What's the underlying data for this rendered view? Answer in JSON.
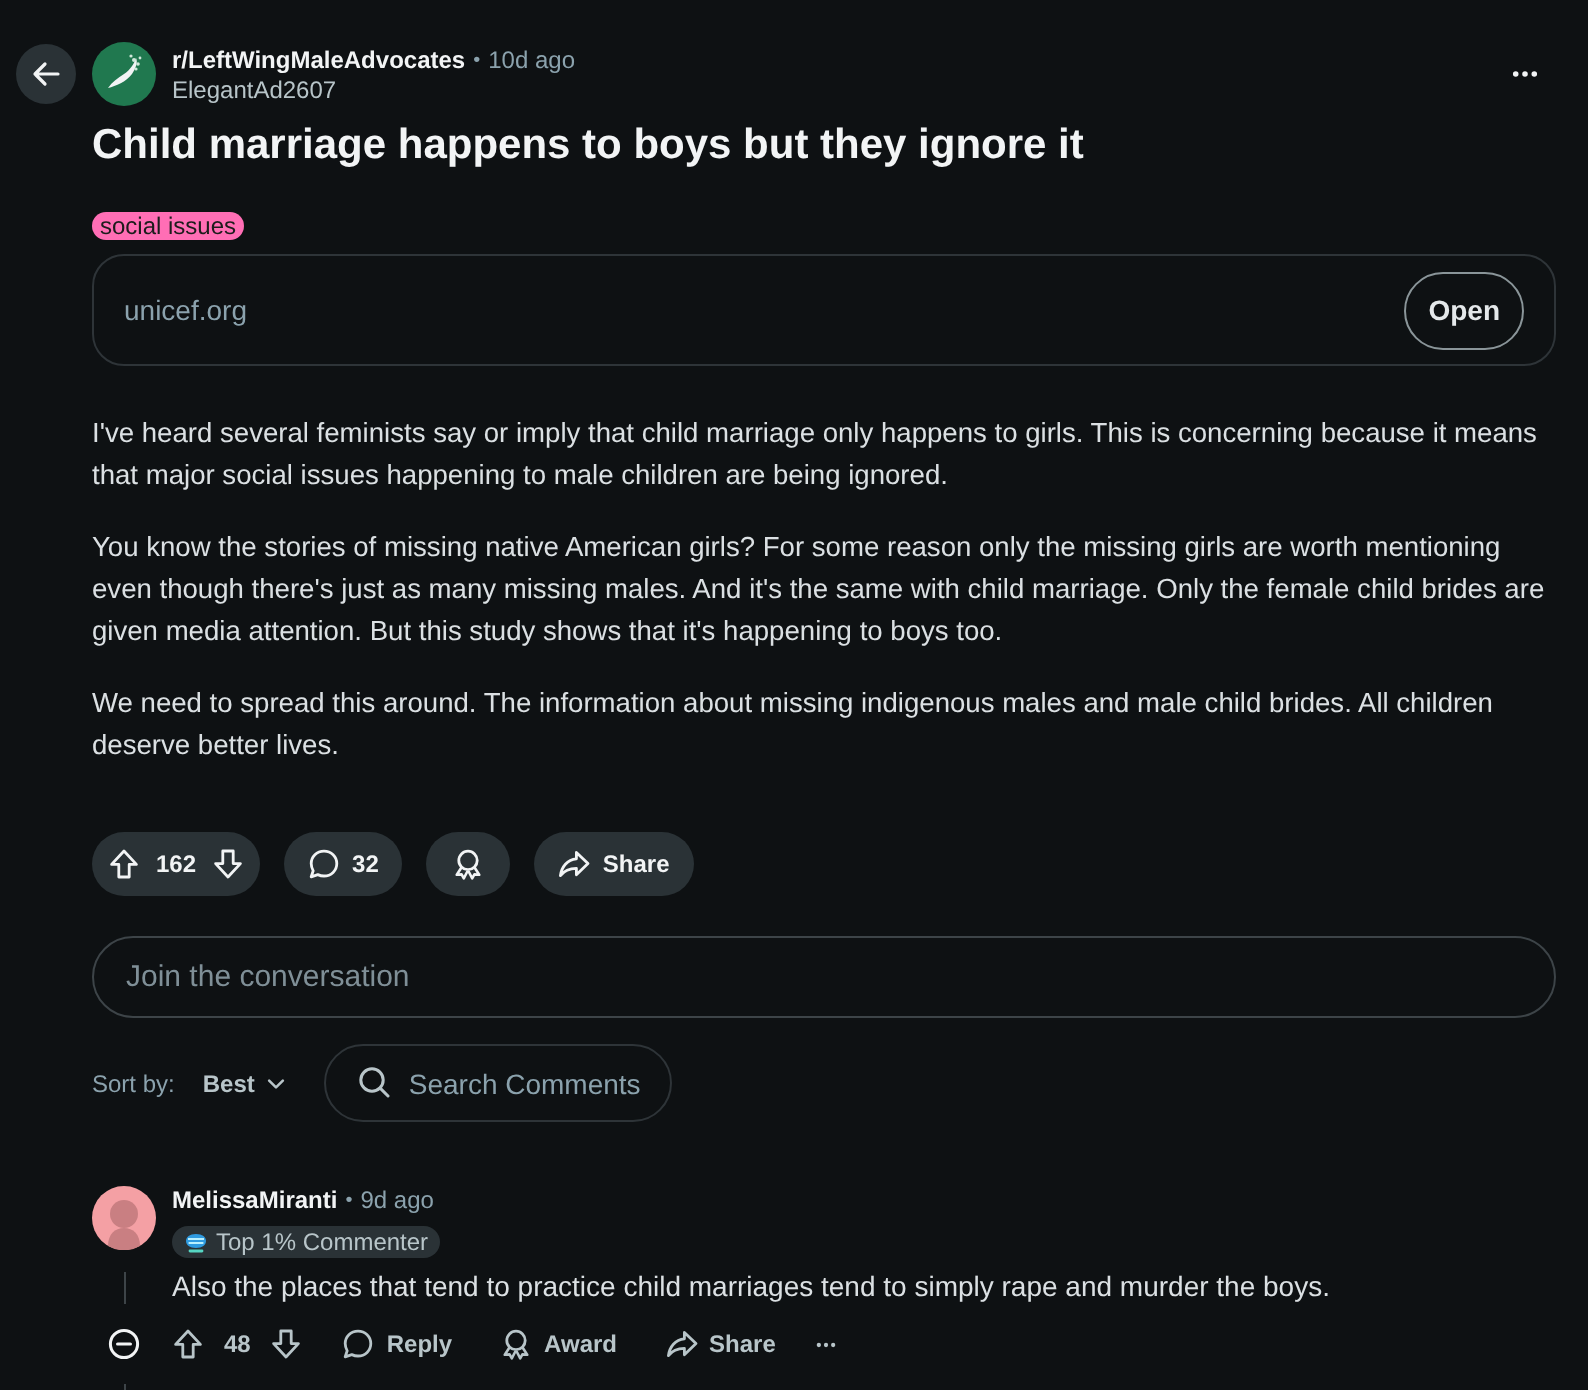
{
  "header": {
    "subreddit": "r/LeftWingMaleAdvocates",
    "separator": "•",
    "time": "10d ago",
    "author": "ElegantAd2607"
  },
  "post": {
    "title": "Child marriage happens to boys but they ignore it",
    "flair": "social issues",
    "link": {
      "domain": "unicef.org",
      "button": "Open"
    },
    "body": [
      "I've heard several feminists say or imply that child marriage only happens to girls. This is concerning because it means that major social issues happening to male children are being ignored.",
      "You know the stories of missing native American girls? For some reason only the missing girls are worth mentioning even though there's just as many missing males. And it's the same with child marriage. Only the female child brides are given media attention. But this study shows that it's happening to boys too.",
      "We need to spread this around. The information about missing indigenous males and male child brides. All children deserve better lives."
    ],
    "votes": "162",
    "comments": "32",
    "share": "Share"
  },
  "composer": {
    "placeholder": "Join the conversation"
  },
  "sort": {
    "label": "Sort by:",
    "value": "Best",
    "search_placeholder": "Search Comments"
  },
  "comments": [
    {
      "author": "MelissaMiranti",
      "separator": "•",
      "time": "9d ago",
      "badge": "Top 1% Commenter",
      "text": "Also the places that tend to practice child marriages tend to simply rape and murder the boys.",
      "expanded": true,
      "votes": "48",
      "actions": [
        {
          "kind": "reply",
          "label": "Reply"
        },
        {
          "kind": "award",
          "label": "Award"
        },
        {
          "kind": "share",
          "label": "Share"
        }
      ]
    }
  ]
}
